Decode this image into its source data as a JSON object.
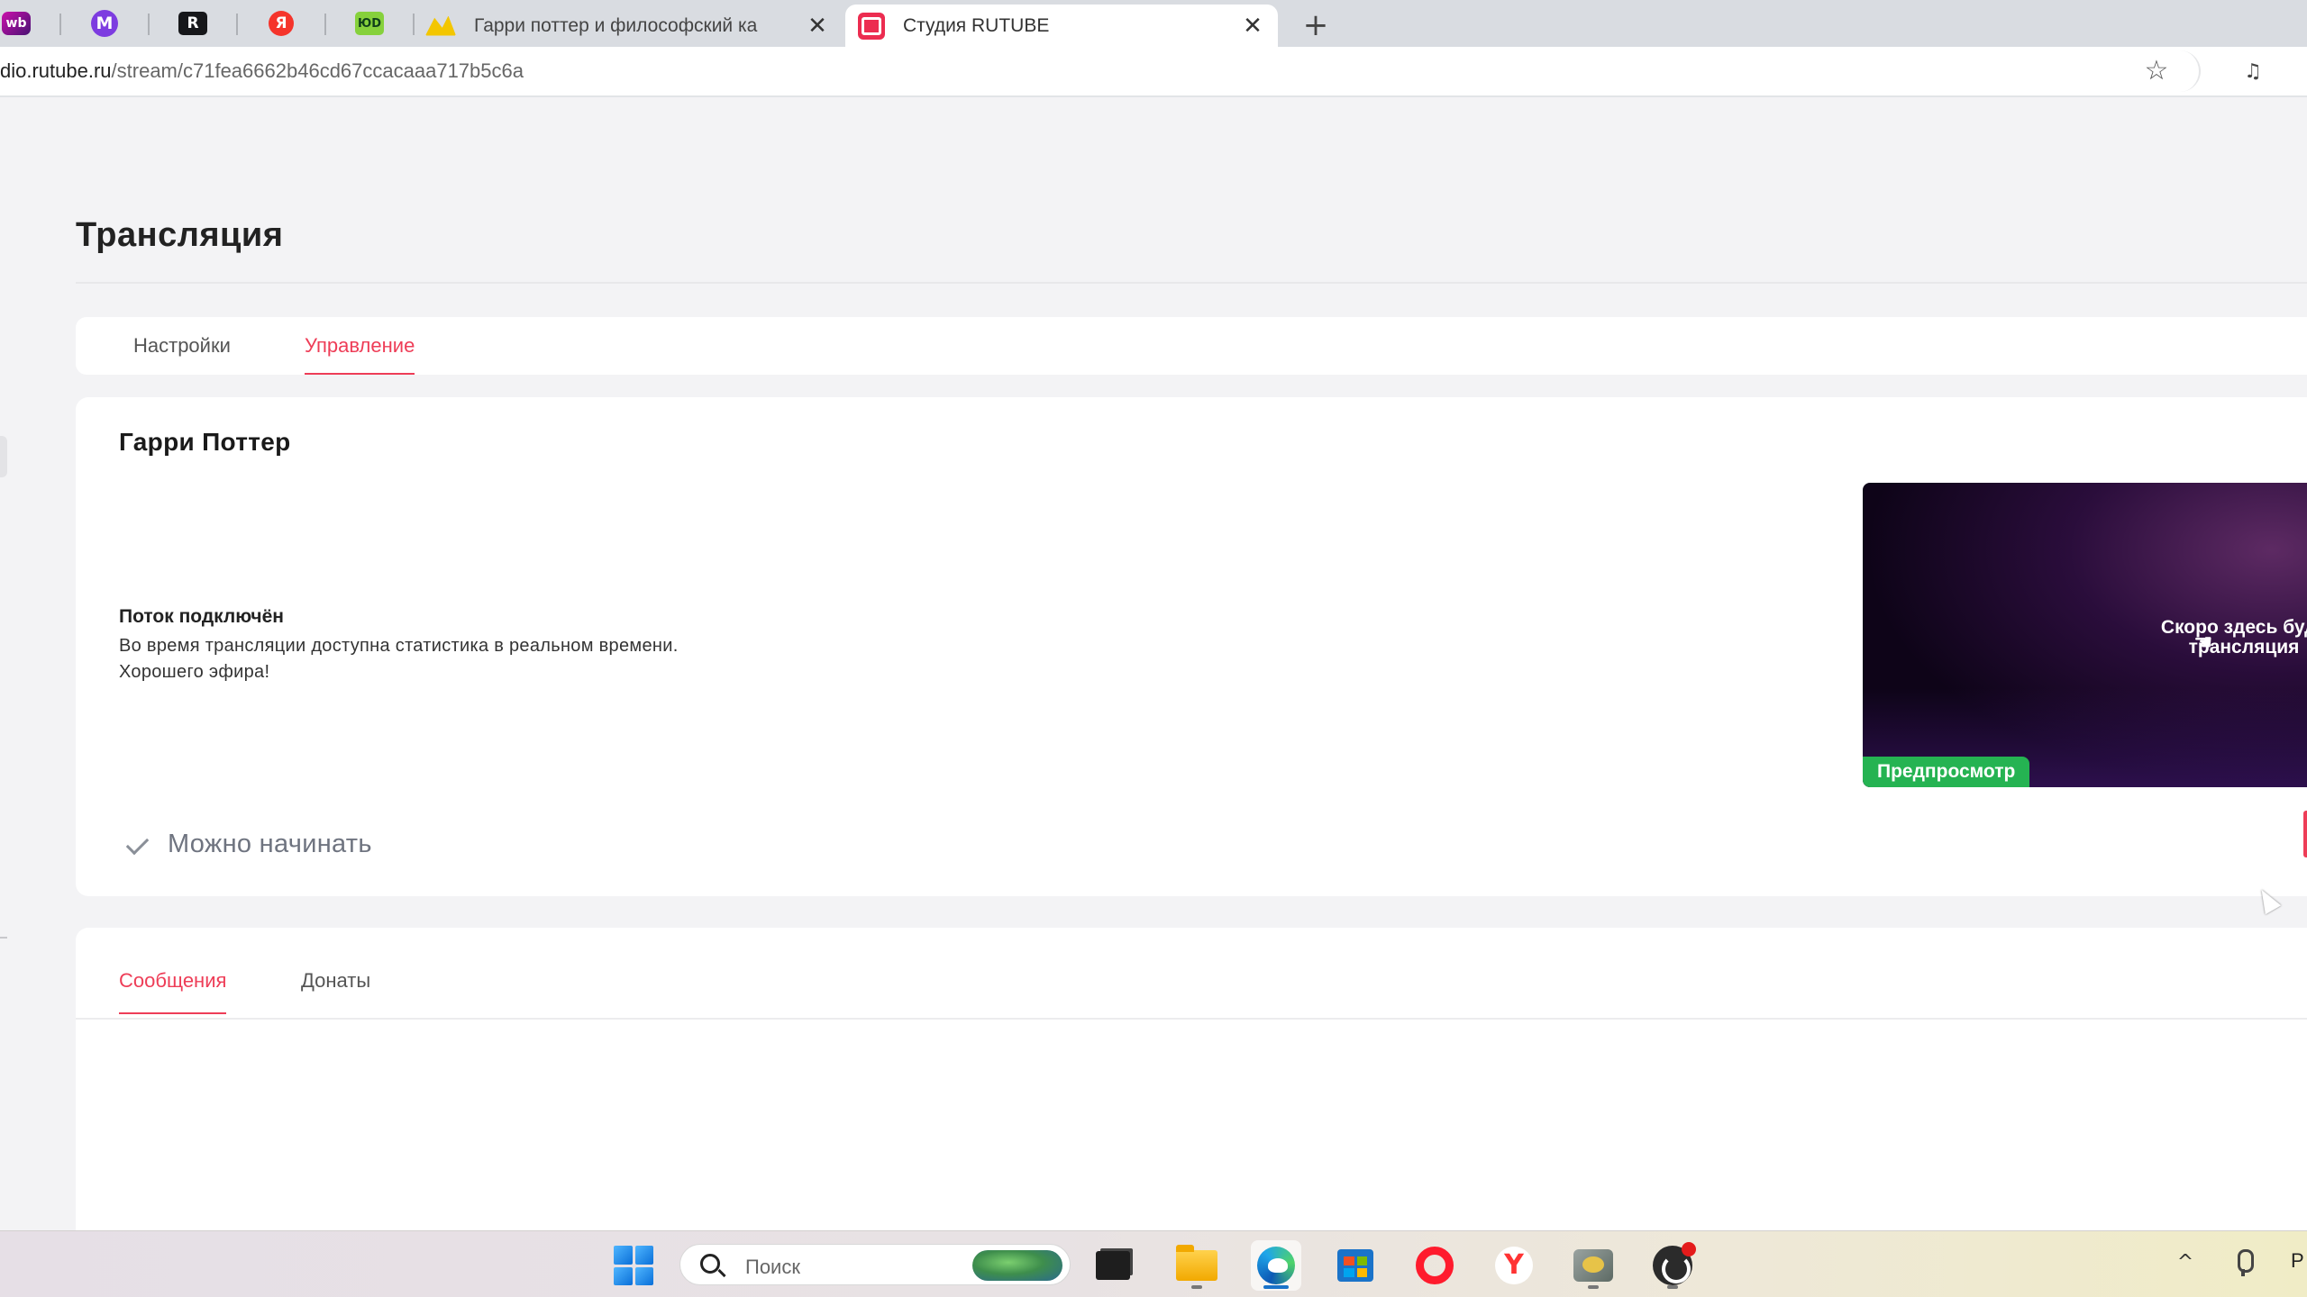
{
  "browser": {
    "pinned_tabs": [
      {
        "name": "wildberries-tab",
        "icon": "wildberries-icon",
        "glyph": "wb"
      },
      {
        "name": "mail-tab",
        "icon": "m-logo-icon",
        "glyph": "M"
      },
      {
        "name": "r-tab",
        "icon": "r-logo-icon",
        "glyph": "R"
      },
      {
        "name": "yandex-tab",
        "icon": "yandex-icon",
        "glyph": "Я"
      },
      {
        "name": "green-tab",
        "icon": "green-logo-icon",
        "glyph": "ЮD"
      }
    ],
    "tabs": [
      {
        "title": "Гарри поттер и философский ка",
        "icon": "harry-potter-icon",
        "close": "✕"
      },
      {
        "title": "Студия RUTUBE",
        "icon": "rutube-icon",
        "close": "✕",
        "active": true
      }
    ],
    "new_tab": "+",
    "url_host": "dio.rutube.ru",
    "url_path": "/stream/c71fea6662b46cd67ccacaaa717b5c6a",
    "star": "☆",
    "extension_icon": "♫"
  },
  "page": {
    "title": "Трансляция",
    "tabs": [
      {
        "label": "Настройки",
        "active": false
      },
      {
        "label": "Управление",
        "active": true
      }
    ],
    "stream": {
      "name": "Гарри Поттер",
      "status_heading": "Поток подключён",
      "status_line1": "Во время трансляции доступна статистика в реальном времени.",
      "status_line2": "Хорошего эфира!",
      "ready_label": "Можно начинать",
      "preview_text_line1": "Скоро здесь буде",
      "preview_text_line2": "трансляция",
      "preview_badge": "Предпросмотр"
    },
    "chat_tabs": [
      {
        "label": "Сообщения",
        "active": true
      },
      {
        "label": "Донаты",
        "active": false
      }
    ]
  },
  "taskbar": {
    "search_label": "Поиск",
    "tray_chevron": "^",
    "tray_lang": "Р"
  },
  "colors": {
    "accent": "#ee3d57",
    "preview_badge": "#25b352",
    "rutube": "#ec2c50"
  }
}
